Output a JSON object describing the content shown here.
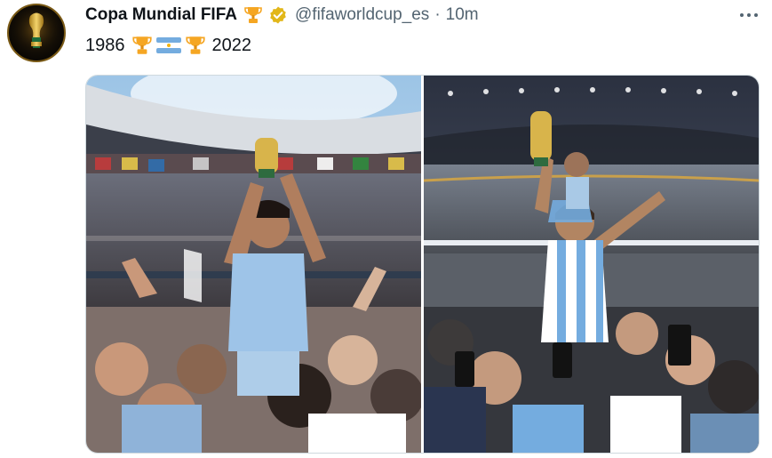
{
  "tweet": {
    "author_name": "Copa Mundial FIFA",
    "handle": "@fifaworldcup_es",
    "separator": "·",
    "time": "10m",
    "text_year_start": "1986",
    "text_year_end": "2022"
  },
  "icons": {
    "trophy": "trophy-icon",
    "verified": "verified-badge-icon",
    "flag": "argentina-flag-icon",
    "more": "more-options-icon"
  },
  "colors": {
    "verified_gold": "#e2b719",
    "text_secondary": "#536471",
    "argentina_blue": "#74acdf"
  }
}
